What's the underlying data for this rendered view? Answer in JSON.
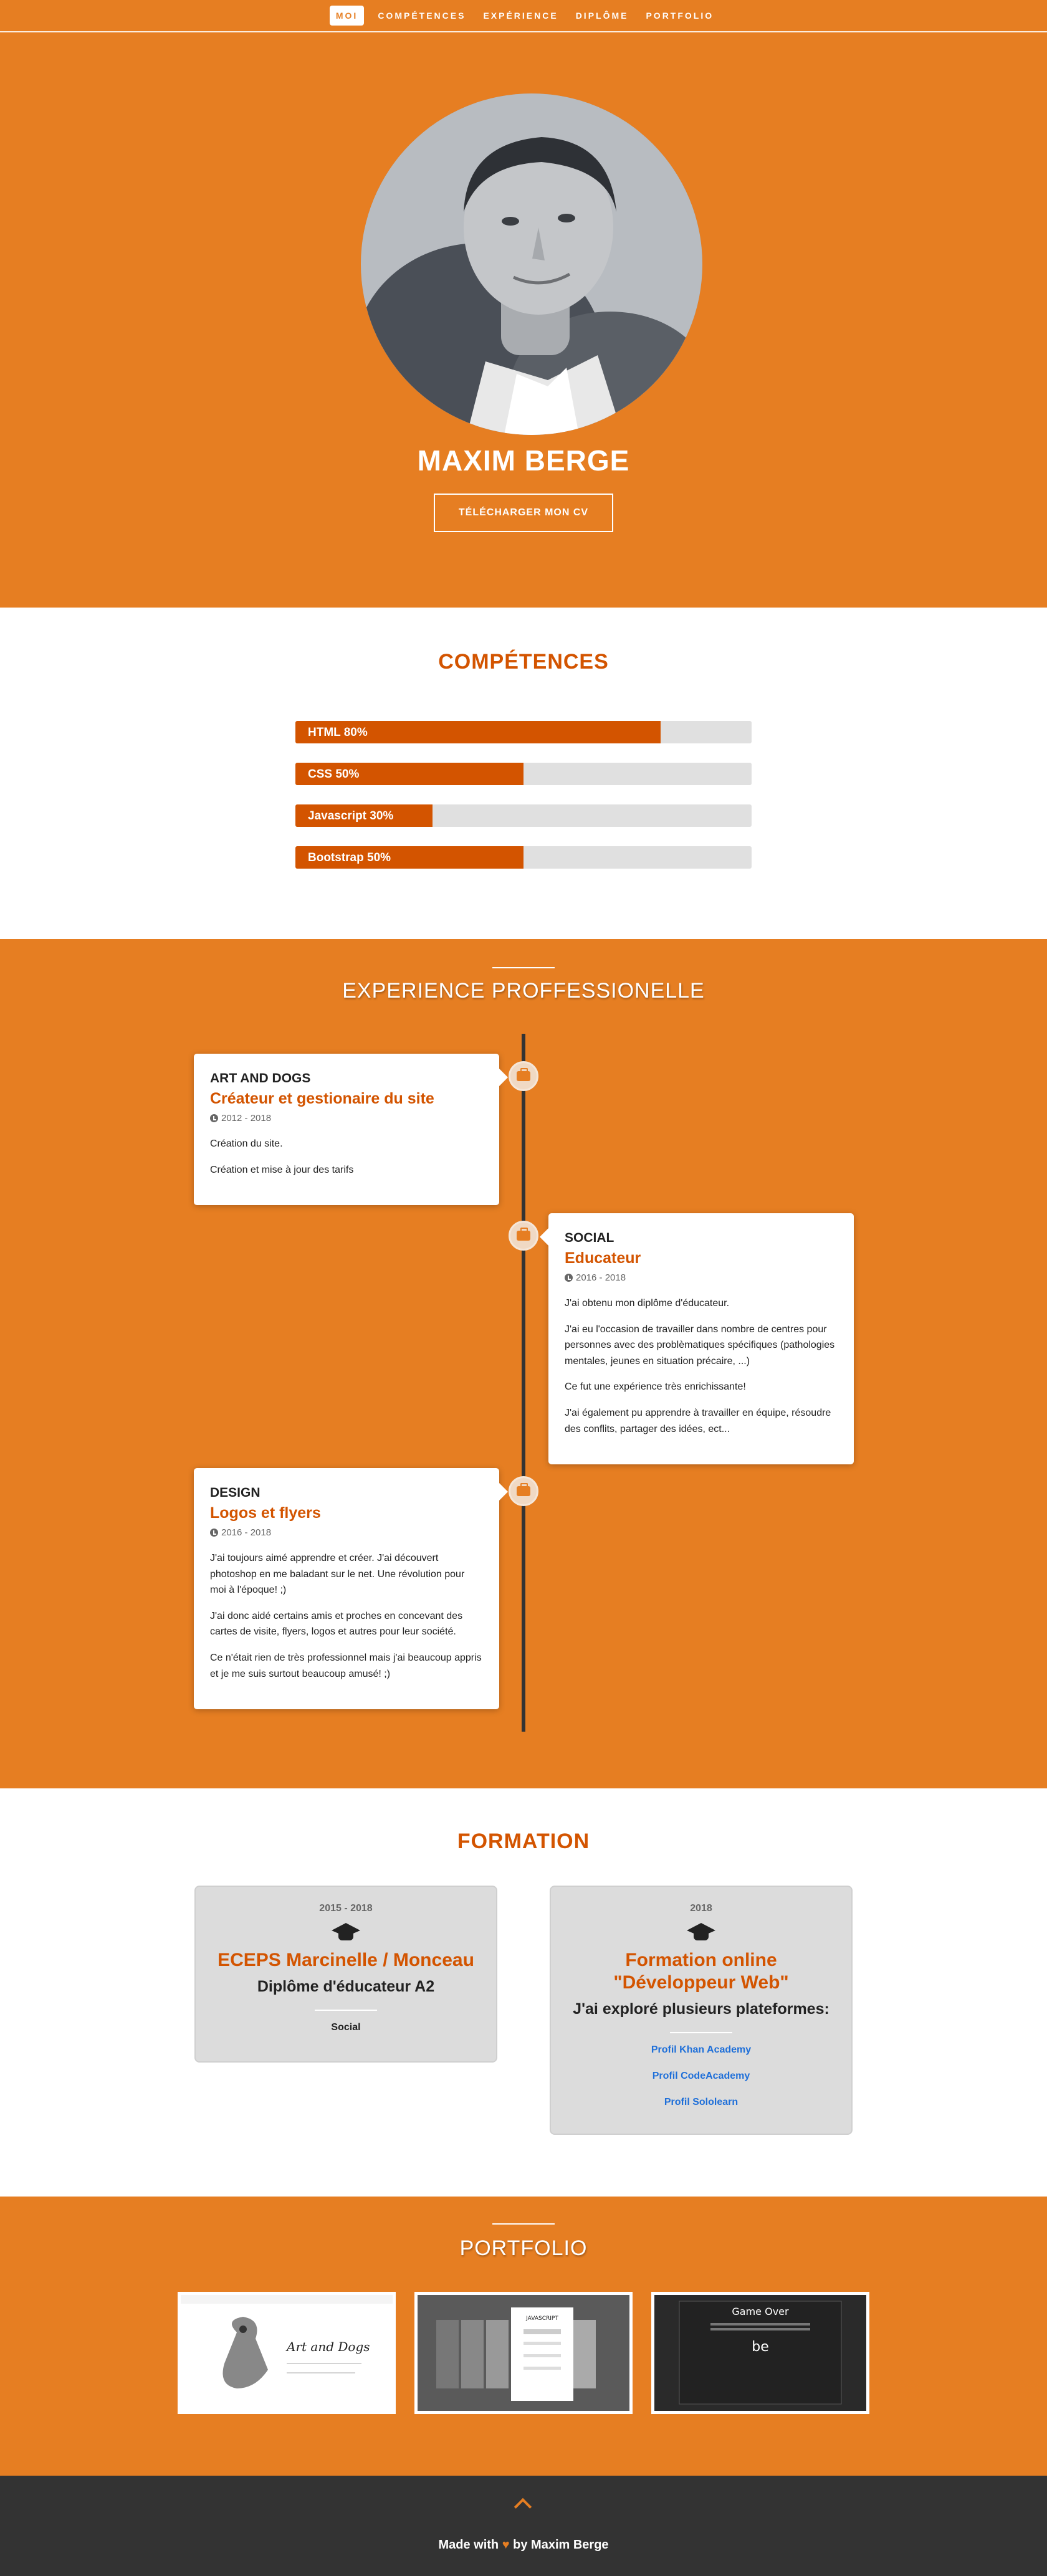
{
  "nav": {
    "items": [
      {
        "label": "MOI",
        "active": true
      },
      {
        "label": "COMPÉTENCES",
        "active": false
      },
      {
        "label": "EXPÉRIENCE",
        "active": false
      },
      {
        "label": "DIPLÔME",
        "active": false
      },
      {
        "label": "PORTFOLIO",
        "active": false
      }
    ]
  },
  "hero": {
    "name": "MAXIM BERGE",
    "cv_button": "TÉLÉCHARGER MON CV"
  },
  "skills": {
    "title": "COMPÉTENCES",
    "items": [
      {
        "label": "HTML 80%",
        "percent": 80
      },
      {
        "label": "CSS 50%",
        "percent": 50
      },
      {
        "label": "Javascript 30%",
        "percent": 30
      },
      {
        "label": "Bootstrap 50%",
        "percent": 50
      }
    ]
  },
  "experience": {
    "title": "EXPERIENCE PROFFESSIONELLE",
    "items": [
      {
        "company": "ART AND DOGS",
        "role": "Créateur et gestionaire du site",
        "dates": "2012 - 2018",
        "paragraphs": [
          "Création du site.",
          "Création et mise à jour des tarifs"
        ]
      },
      {
        "company": "SOCIAL",
        "role": "Educateur",
        "dates": "2016 - 2018",
        "paragraphs": [
          "J'ai obtenu mon diplôme d'éducateur.",
          "J'ai eu l'occasion de travailler dans nombre de centres pour personnes avec des problèmatiques spécifiques (pathologies mentales, jeunes en situation précaire, ...)",
          "Ce fut une expérience très enrichissante!",
          "J'ai également pu apprendre à travailler en équipe, résoudre des conflits, partager des idées, ect..."
        ]
      },
      {
        "company": "DESIGN",
        "role": "Logos et flyers",
        "dates": "2016 - 2018",
        "paragraphs": [
          "J'ai toujours aimé apprendre et créer. J'ai découvert photoshop en me baladant sur le net. Une révolution pour moi à l'époque! ;)",
          "J'ai donc aidé certains amis et proches en concevant des cartes de visite, flyers, logos et autres pour leur société.",
          "Ce n'était rien de très professionnel mais j'ai beaucoup appris et je me suis surtout beaucoup amusé! ;)"
        ]
      }
    ]
  },
  "formation": {
    "title": "FORMATION",
    "items": [
      {
        "year": "2015 - 2018",
        "school": "ECEPS Marcinelle / Monceau",
        "degree": "Diplôme d'éducateur A2",
        "tag": "Social"
      },
      {
        "year": "2018",
        "school": "Formation online \"Développeur Web\"",
        "degree": "J'ai exploré plusieurs plateformes:",
        "links": [
          "Profil Khan Academy",
          "Profil CodeAcademy",
          "Profil Sololearn"
        ]
      }
    ]
  },
  "portfolio": {
    "title": "PORTFOLIO",
    "items": [
      {
        "text": "Art and Dogs"
      },
      {
        "text": "JAVASCRIPT"
      },
      {
        "text": "Game Over",
        "subtext": "be"
      }
    ]
  },
  "footer": {
    "made_with": "Made with",
    "heart": "♥",
    "by": "by Maxim Berge"
  }
}
